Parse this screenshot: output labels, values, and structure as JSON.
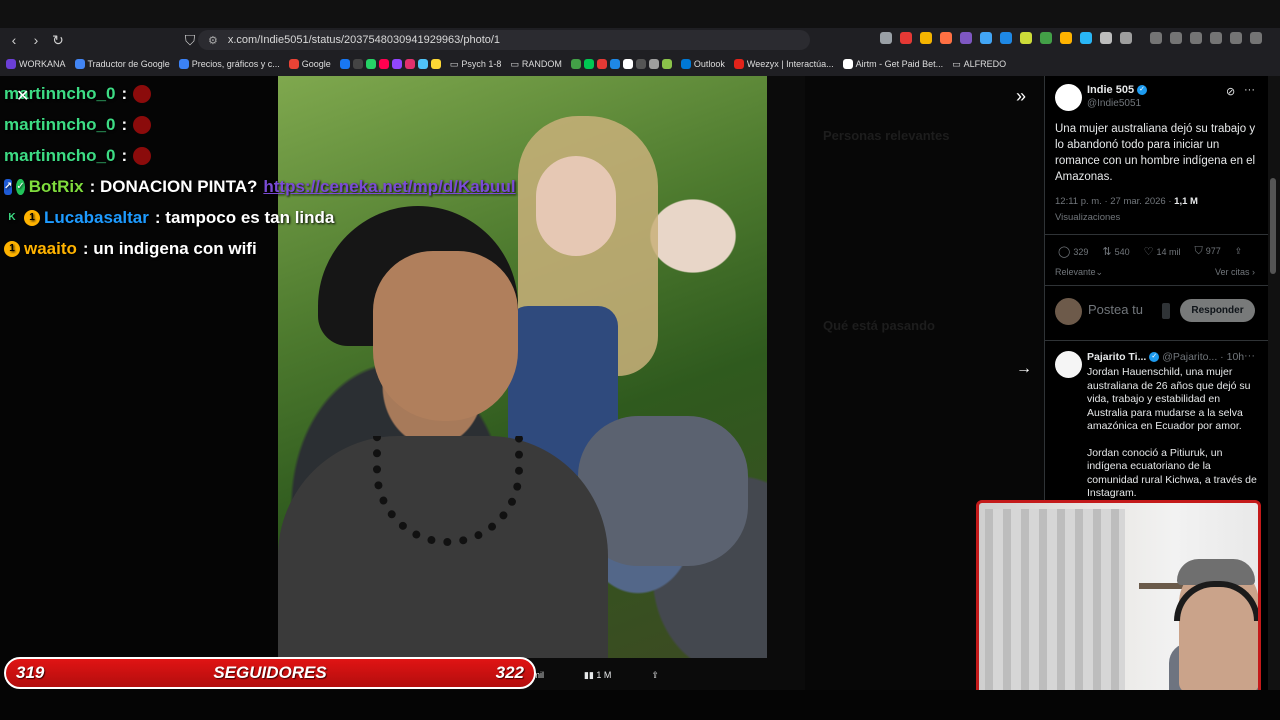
{
  "browser": {
    "url": "x.com/Indie5051/status/2037548030941929963/photo/1",
    "bookmarks": [
      {
        "label": "WORKANA",
        "color": "#6b3fd6"
      },
      {
        "label": "Traductor de Google",
        "color": "#4285f4"
      },
      {
        "label": "Precios, gráficos y c...",
        "color": "#3b82f6"
      },
      {
        "label": "Google",
        "color": "#ea4335"
      },
      {
        "label": "Psych 1-8",
        "color": "#9aa0a6"
      },
      {
        "label": "RANDOM",
        "color": "#9aa0a6"
      },
      {
        "label": "Outlook",
        "color": "#0078d4"
      },
      {
        "label": "Weezyx | Interactúa...",
        "color": "#e2231a"
      },
      {
        "label": "Airtm - Get Paid Bet...",
        "color": "#ffffff"
      },
      {
        "label": "ALFREDO",
        "color": "#9aa0a6"
      }
    ]
  },
  "chat": [
    {
      "user": "martinncho_0",
      "user_color": "#3ddc84",
      "text": "",
      "emote": true
    },
    {
      "user": "martinncho_0",
      "user_color": "#3ddc84",
      "text": "",
      "emote": true
    },
    {
      "user": "martinncho_0",
      "user_color": "#3ddc84",
      "text": "",
      "emote": true
    },
    {
      "user": "BotRix",
      "user_color": "#7fdc3d",
      "text": "DONACION PINTA?",
      "link": "https://ceneka.net/mp/d/Kabuul"
    },
    {
      "user": "Lucabasaltar",
      "user_color": "#1e9bff",
      "text": "tampoco es tan linda"
    },
    {
      "user": "waaito",
      "user_color": "#ffb300",
      "text": "un indigena con wifi"
    }
  ],
  "followers": {
    "current": "319",
    "label": "SEGUIDORES",
    "goal": "322"
  },
  "photo_stats": {
    "likes": "14 mil",
    "views": "1 M"
  },
  "tweet": {
    "author": "Indie 505",
    "handle": "@Indie5051",
    "text": "Una mujer australiana dejó su trabajo y lo abandonó todo para iniciar un romance con un hombre indígena en el Amazonas.",
    "time": "12:11 p. m. · 27 mar. 2026 · ",
    "views_count": "1,1 M",
    "views_label": "Visualizaciones",
    "replies": "329",
    "retweets": "540",
    "likes": "14 mil",
    "bookmarks": "977",
    "sort_label": "Relevante",
    "quotes_label": "Ver citas",
    "reply_placeholder": "Postea tu",
    "reply_button": "Responder"
  },
  "reply": {
    "author": "Pajarito Ti...",
    "handle": "@Pajarito...",
    "time": "10h",
    "paragraphs": [
      "Jordan Hauenschild, una mujer australiana de 26 años que dejó su vida, trabajo y estabilidad en Australia para mudarse a la selva amazónica en Ecuador por amor.",
      "Jordan conoció a Pitiuruk, un indígena ecuatoriano de la comunidad rural Kichwa, a través de Instagram."
    ]
  },
  "dimmed": {
    "relevant_people": "Personas relevantes",
    "whats_happening": "Qué está pasando"
  },
  "colors": {
    "accent": "#1d9bf0",
    "follow_bar": "#e01414",
    "webcam_border": "#c41a1a"
  }
}
